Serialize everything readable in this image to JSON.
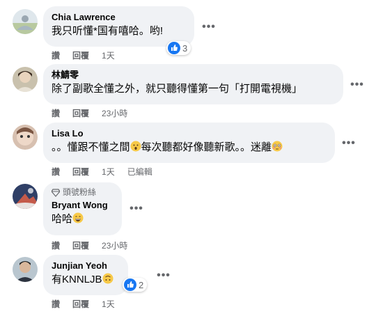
{
  "colors": {
    "bubble": "#f0f2f5",
    "text": "#050505",
    "secondary": "#65676b",
    "like_blue": "#1877f2"
  },
  "comments": [
    {
      "name": "Chia Lawrence",
      "text": "我只听懂*国有嘻哈。哟!",
      "actions": {
        "like": "讚",
        "reply": "回覆",
        "time": "1天"
      },
      "reaction_count": "3"
    },
    {
      "name": "林鯖零",
      "text": "除了副歌全懂之外，就只聽得懂第一句「打開電視機」",
      "actions": {
        "like": "讚",
        "reply": "回覆",
        "time": "23小時"
      }
    },
    {
      "name": "Lisa Lo",
      "text_a": "。。懂跟不懂之間",
      "text_b": "每次聽都好像聽新歌。。迷離",
      "actions": {
        "like": "讚",
        "reply": "回覆",
        "time": "1天",
        "edited": "已編輯"
      }
    },
    {
      "badge": "頭號粉絲",
      "name": "Bryant Wong",
      "text": "哈哈",
      "actions": {
        "like": "讚",
        "reply": "回覆",
        "time": "23小時"
      }
    },
    {
      "name": "Junjian Yeoh",
      "text": "有KNNLJB",
      "actions": {
        "like": "讚",
        "reply": "回覆",
        "time": "1天"
      },
      "reaction_count": "2"
    }
  ],
  "icons": {
    "more": "more-options-icon",
    "like": "like-reaction-icon",
    "diamond": "top-fan-diamond-icon"
  }
}
